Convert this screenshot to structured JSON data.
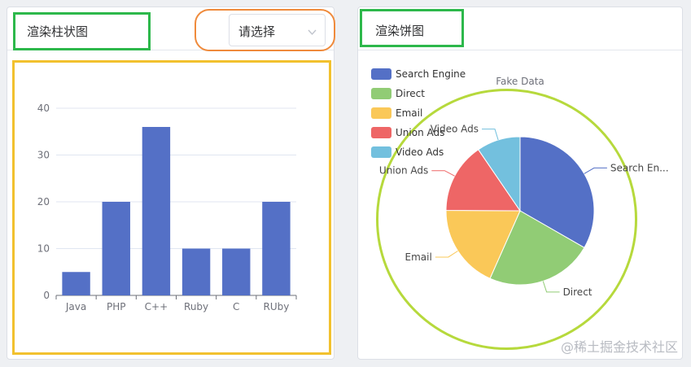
{
  "bar_panel": {
    "title": "渲染柱状图",
    "select_placeholder": "请选择"
  },
  "pie_panel": {
    "title": "渲染饼图"
  },
  "watermark": "@稀土掘金技术社区",
  "colors": {
    "bar": "#5470c6",
    "pie": [
      "#5470c6",
      "#91cc75",
      "#fac858",
      "#ee6666",
      "#73c0de"
    ]
  },
  "chart_data": [
    {
      "type": "bar",
      "categories": [
        "Java",
        "PHP",
        "C++",
        "Ruby",
        "C",
        "RUby"
      ],
      "values": [
        5,
        20,
        36,
        10,
        10,
        20
      ],
      "ylim": [
        0,
        40
      ],
      "yticks": [
        0,
        10,
        20,
        30,
        40
      ],
      "grid": true
    },
    {
      "type": "pie",
      "title": "Fake Data",
      "legend_position": "top-left",
      "series": [
        {
          "name": "Search Engine",
          "value": 1048,
          "label": "Search En..."
        },
        {
          "name": "Direct",
          "value": 735,
          "label": "Direct"
        },
        {
          "name": "Email",
          "value": 580,
          "label": "Email"
        },
        {
          "name": "Union Ads",
          "value": 484,
          "label": "Union Ads"
        },
        {
          "name": "Video Ads",
          "value": 300,
          "label": "Video Ads"
        }
      ]
    }
  ]
}
